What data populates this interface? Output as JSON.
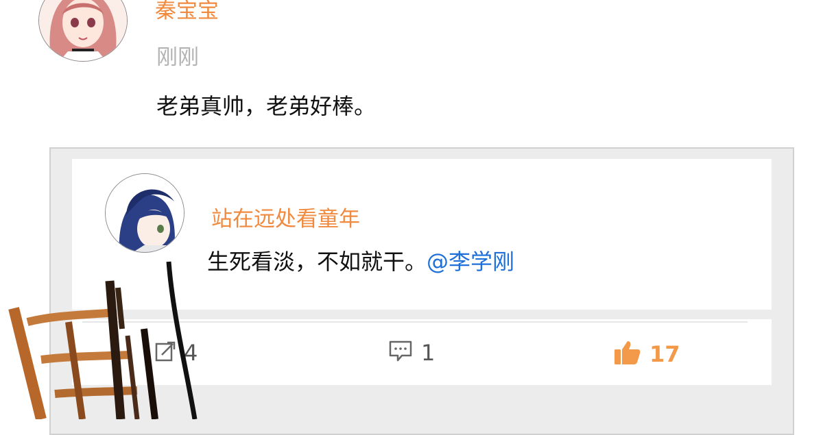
{
  "post": {
    "username": "秦宝宝",
    "timestamp": "刚刚",
    "text": "老弟真帅，老弟好棒。"
  },
  "reply": {
    "username": "站在远处看童年",
    "text": "生死看淡，不如就干。",
    "mention": "@李学刚"
  },
  "actions": {
    "share_count": "4",
    "comment_count": "1",
    "like_count": "17"
  },
  "colors": {
    "username": "#f08a3e",
    "mention": "#1e6fd9",
    "like": "#f29a4a"
  },
  "icons": {
    "share": "share-icon",
    "comment": "comment-icon",
    "like": "thumbs-up-icon"
  }
}
